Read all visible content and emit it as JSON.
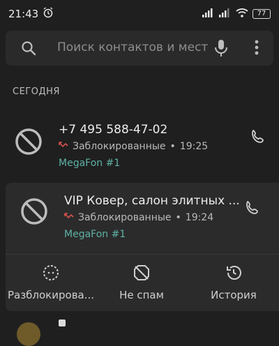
{
  "status_bar": {
    "time": "21:43",
    "battery": "77",
    "icons": [
      "alarm-icon",
      "signal-icon",
      "signal-icon",
      "wifi-icon",
      "battery-icon"
    ]
  },
  "search": {
    "placeholder": "Поиск контактов и мест"
  },
  "section": {
    "title": "СЕГОДНЯ"
  },
  "calls": [
    {
      "name": "+7 495 588-47-02",
      "status": "Заблокированные",
      "time": "19:25",
      "sim": "MegaFon #1",
      "separator": "•"
    },
    {
      "name": "VIP Ковер, салон элитных ...",
      "status": "Заблокированные",
      "time": "19:24",
      "sim": "MegaFon #1",
      "separator": "•"
    }
  ],
  "actions": {
    "unblock": "Разблокирова...",
    "not_spam": "Не спам",
    "history": "История"
  },
  "colors": {
    "background": "#1f1f1f",
    "surface": "#2a2a2a",
    "sim_accent": "#5fb2a6",
    "missed_call": "#d9534f"
  }
}
